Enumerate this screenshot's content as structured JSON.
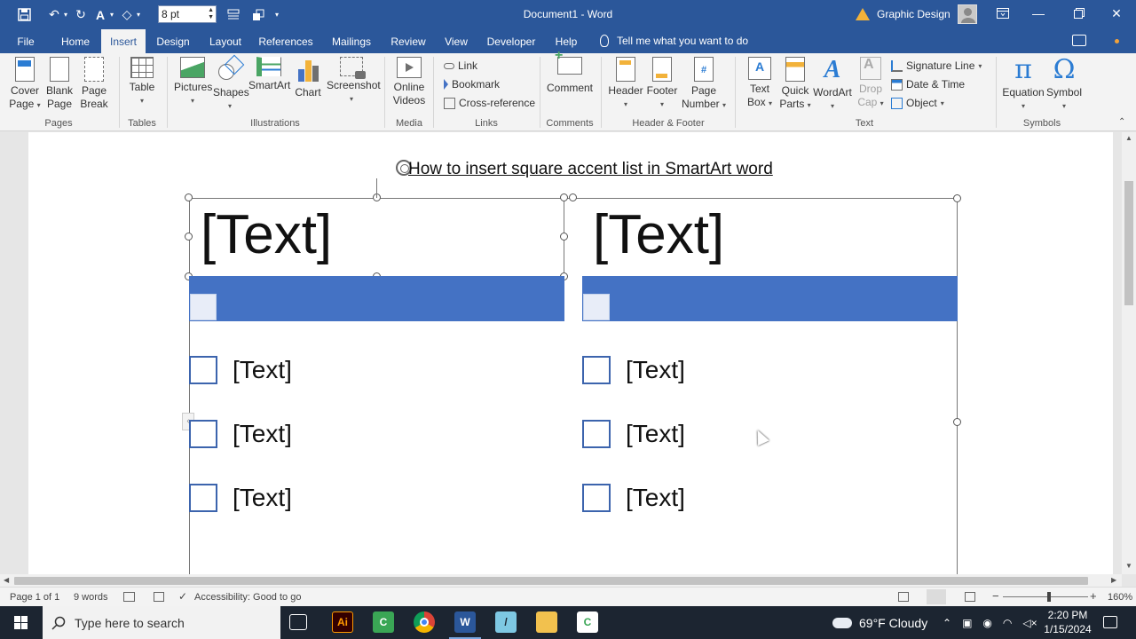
{
  "titlebar": {
    "font_size_value": "8 pt",
    "doc_title": "Document1  -  Word",
    "user_name": "Graphic Design"
  },
  "tabs": [
    "File",
    "Home",
    "Insert",
    "Design",
    "Layout",
    "References",
    "Mailings",
    "Review",
    "View",
    "Developer",
    "Help"
  ],
  "active_tab": "Insert",
  "tell_me": "Tell me what you want to do",
  "ribbon": {
    "pages": {
      "cover": "Cover",
      "cover2": "Page",
      "blank": "Blank",
      "blank2": "Page",
      "break": "Page",
      "break2": "Break",
      "label": "Pages"
    },
    "tables": {
      "table": "Table",
      "label": "Tables"
    },
    "illustrations": {
      "pictures": "Pictures",
      "shapes": "Shapes",
      "smartart": "SmartArt",
      "chart": "Chart",
      "screenshot": "Screenshot",
      "label": "Illustrations"
    },
    "media": {
      "online": "Online",
      "videos": "Videos",
      "label": "Media"
    },
    "links": {
      "link": "Link",
      "bookmark": "Bookmark",
      "crossref": "Cross-reference",
      "label": "Links"
    },
    "comments": {
      "comment": "Comment",
      "label": "Comments"
    },
    "headerfooter": {
      "header": "Header",
      "footer": "Footer",
      "pagenum": "Page",
      "pagenum2": "Number",
      "label": "Header & Footer"
    },
    "text": {
      "textbox": "Text",
      "textbox2": "Box",
      "quick": "Quick",
      "quick2": "Parts",
      "wordart": "WordArt",
      "dropcap": "Drop",
      "dropcap2": "Cap",
      "sigline": "Signature Line",
      "datetime": "Date & Time",
      "object": "Object",
      "label": "Text"
    },
    "symbols": {
      "equation": "Equation",
      "symbol": "Symbol",
      "label": "Symbols"
    }
  },
  "document": {
    "heading": "How to insert square accent list in SmartArt word",
    "left_title": "[Text]",
    "right_title": "[Text]",
    "left_items": [
      "[Text]",
      "[Text]",
      "[Text]"
    ],
    "right_items": [
      "[Text]",
      "[Text]",
      "[Text]"
    ]
  },
  "statusbar": {
    "page": "Page 1 of 1",
    "words": "9 words",
    "accessibility": "Accessibility: Good to go",
    "zoom": "160%"
  },
  "taskbar": {
    "search_placeholder": "Type here to search",
    "weather": "69°F  Cloudy",
    "time": "2:20 PM",
    "date": "1/15/2024"
  },
  "colors": {
    "accent": "#2b579a",
    "smartart_accent": "#4472c4"
  }
}
